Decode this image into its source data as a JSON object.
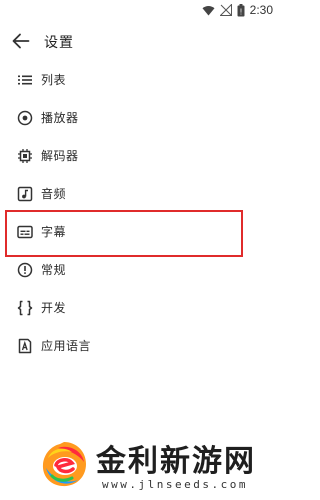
{
  "status_bar": {
    "time": "2:30",
    "icons": [
      "wifi-icon",
      "signal-icon",
      "battery-icon"
    ]
  },
  "app_bar": {
    "back_icon": "arrow-left-icon",
    "title": "设置"
  },
  "menu": {
    "items": [
      {
        "icon": "list-icon",
        "label": "列表"
      },
      {
        "icon": "player-icon",
        "label": "播放器"
      },
      {
        "icon": "chip-icon",
        "label": "解码器"
      },
      {
        "icon": "music-note-icon",
        "label": "音频"
      },
      {
        "icon": "subtitles-icon",
        "label": "字幕"
      },
      {
        "icon": "info-icon",
        "label": "常规"
      },
      {
        "icon": "code-icon",
        "label": "开发"
      },
      {
        "icon": "language-icon",
        "label": "应用语言"
      }
    ],
    "highlighted_index": 4
  },
  "watermark": {
    "title": "金利新游网",
    "url": "www.jlnseeds.com"
  },
  "colors": {
    "highlight": "#e02b2b",
    "icon": "#333333"
  }
}
